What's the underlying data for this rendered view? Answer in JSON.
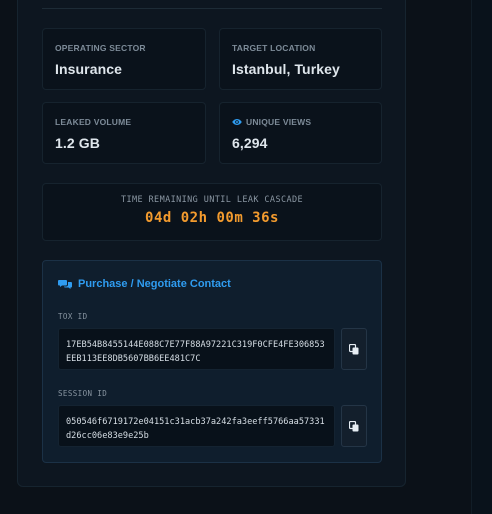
{
  "stats": {
    "operating_sector": {
      "label": "OPERATING SECTOR",
      "value": "Insurance"
    },
    "target_location": {
      "label": "TARGET LOCATION",
      "value": "Istanbul, Turkey"
    },
    "leaked_volume": {
      "label": "LEAKED VOLUME",
      "value": "1.2 GB"
    },
    "unique_views": {
      "label": "UNIQUE VIEWS",
      "value": "6,294",
      "icon": "eye-icon"
    }
  },
  "timer": {
    "label": "TIME REMAINING UNTIL LEAK CASCADE",
    "value": "04d 02h 00m 36s",
    "color": "#f39b2e"
  },
  "contact": {
    "title": "Purchase / Negotiate Contact",
    "title_icon": "chat-icon",
    "accent": "#2f9cf0",
    "tox": {
      "label": "TOX ID",
      "value": "17EB54B8455144E088C7E77F88A97221C319F0CFE4FE306853EEB113EE8DB5607BB6EE481C7C",
      "copy_icon": "copy-icon"
    },
    "session": {
      "label": "SESSION ID",
      "value": "050546f6719172e04151c31acb37a242fa3eeff5766aa57331d26cc06e83e9e25b",
      "copy_icon": "copy-icon"
    }
  }
}
